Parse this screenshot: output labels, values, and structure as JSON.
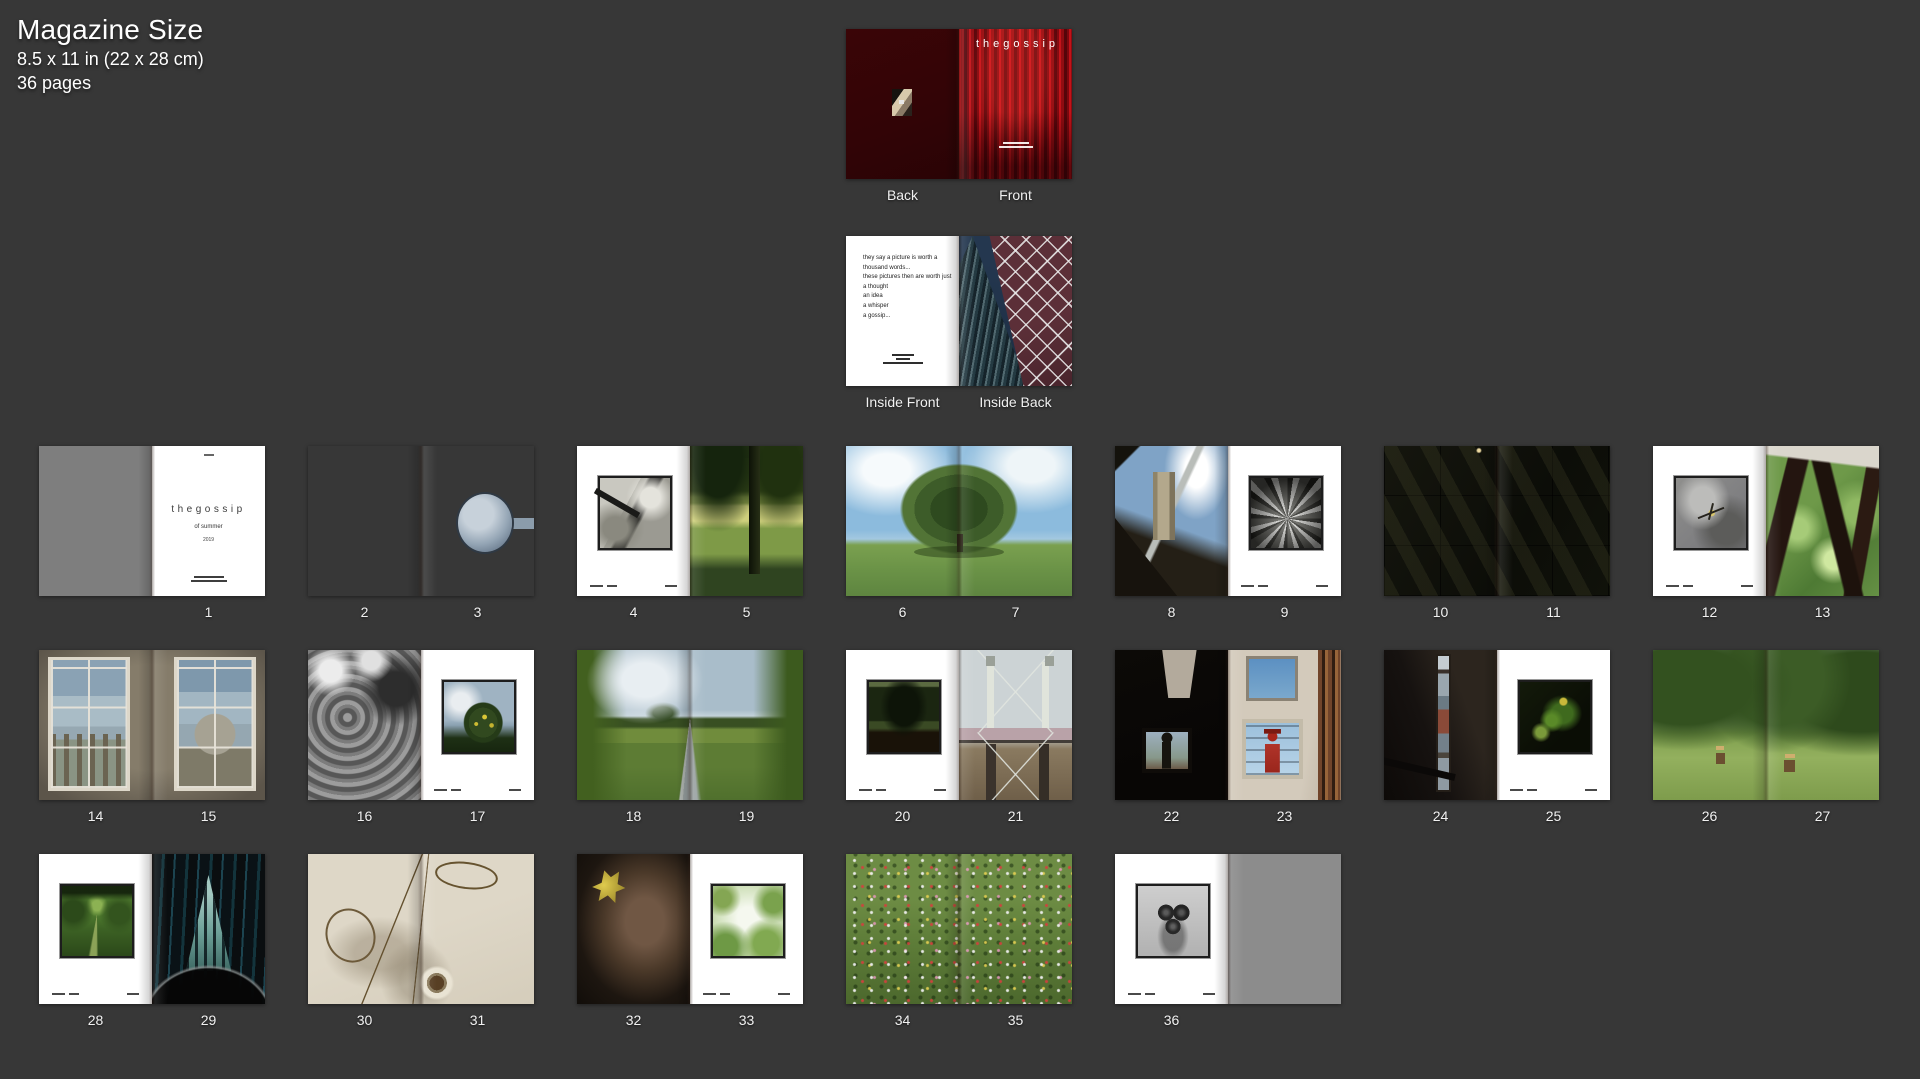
{
  "header": {
    "title": "Magazine Size",
    "size_line": "8.5 x 11 in (22 x 28 cm)",
    "pages_line": "36 pages"
  },
  "cover": {
    "back_label": "Back",
    "front_label": "Front",
    "front_title": "thegossip"
  },
  "inside": {
    "front_label": "Inside Front",
    "back_label": "Inside Back",
    "poem": "they say a picture is worth a\nthousand words...\nthese pictures then are worth just\na thought\nan idea\na whisper\na gossip...",
    "back_art": "building-lattice-photo"
  },
  "title_page": {
    "title": "thegossip",
    "subtitle": "of summer",
    "year": "2019"
  },
  "spreads": [
    {
      "numbers": [
        "",
        "1"
      ],
      "pages": [
        "gray",
        "title"
      ]
    },
    {
      "numbers": [
        "2",
        "3"
      ],
      "full": "lake-horn"
    },
    {
      "numbers": [
        "4",
        "5"
      ],
      "pages": [
        "framed:shadow-bw",
        "photo:tree-field"
      ]
    },
    {
      "numbers": [
        "6",
        "7"
      ],
      "full": "oak"
    },
    {
      "numbers": [
        "8",
        "9"
      ],
      "pages": [
        "photo:tower",
        "framed:leaf-bw"
      ]
    },
    {
      "numbers": [
        "10",
        "11"
      ],
      "full": "dark-panels"
    },
    {
      "numbers": [
        "12",
        "13"
      ],
      "pages": [
        "framed:dragonfly",
        "photo:window-green"
      ]
    },
    {
      "numbers": [
        "14",
        "15"
      ],
      "full": "oxford-windows"
    },
    {
      "numbers": [
        "16",
        "17"
      ],
      "pages": [
        "photo:bw-canopy",
        "framed:tree-yellow"
      ]
    },
    {
      "numbers": [
        "18",
        "19"
      ],
      "full": "road"
    },
    {
      "numbers": [
        "20",
        "21"
      ],
      "pages": [
        "framed:tree-dark",
        "photo:bridge"
      ]
    },
    {
      "numbers": [
        "22",
        "23"
      ],
      "pages": [
        "photo:robot-dark",
        "photo:robot-light"
      ]
    },
    {
      "numbers": [
        "24",
        "25"
      ],
      "pages": [
        "photo:stairwell",
        "framed:foliage-night"
      ]
    },
    {
      "numbers": [
        "26",
        "27"
      ],
      "full": "stumps"
    },
    {
      "numbers": [
        "28",
        "29"
      ],
      "pages": [
        "framed:forest-path",
        "photo:glass-dark"
      ]
    },
    {
      "numbers": [
        "30",
        "31"
      ],
      "full": "wire-wall"
    },
    {
      "numbers": [
        "32",
        "33"
      ],
      "pages": [
        "photo:leaf-spot",
        "framed:canopy-bright"
      ]
    },
    {
      "numbers": [
        "34",
        "35"
      ],
      "full": "meadow"
    },
    {
      "numbers": [
        "36",
        ""
      ],
      "pages": [
        "framed:plums-bw",
        "gray2"
      ]
    }
  ]
}
